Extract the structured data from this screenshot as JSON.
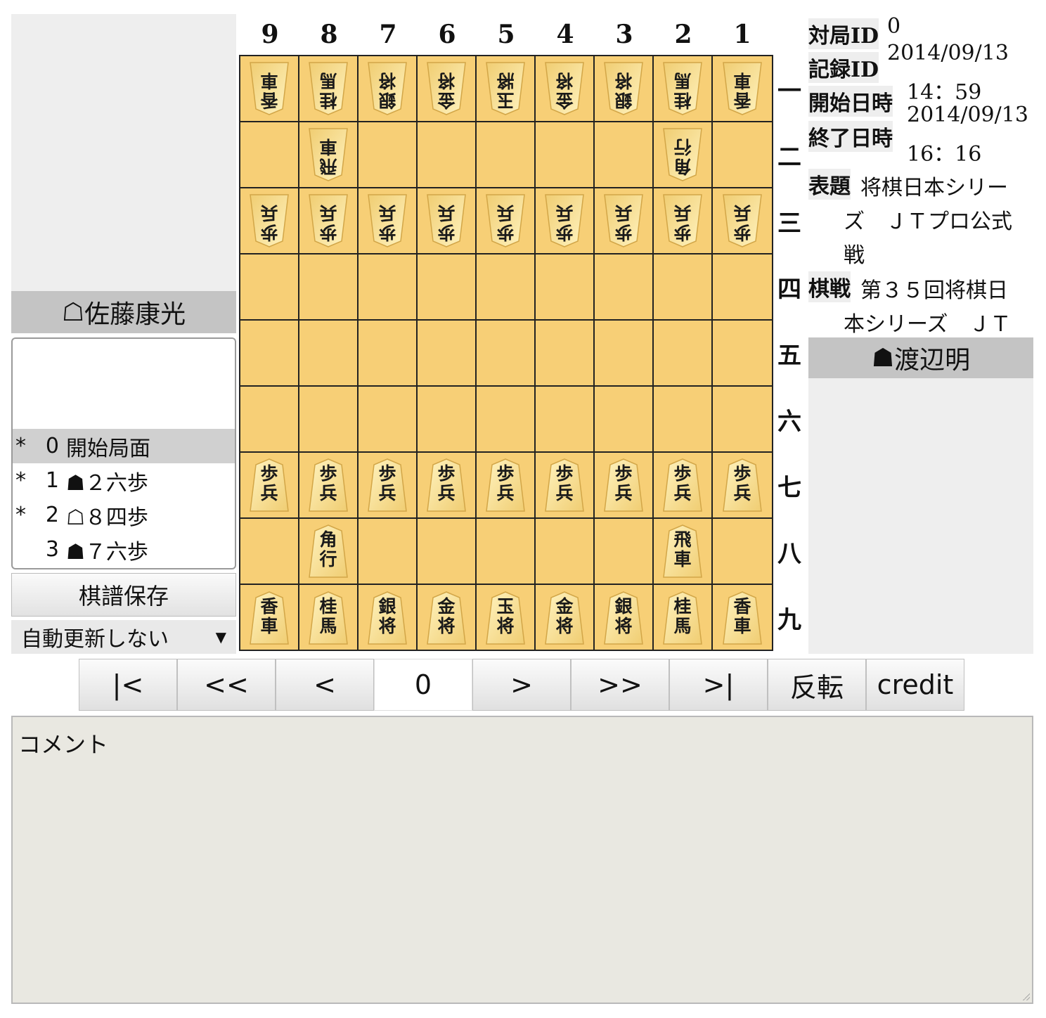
{
  "gote": {
    "mark": "☖",
    "name": "佐藤康光"
  },
  "sente": {
    "mark": "☗",
    "name": "渡辺明"
  },
  "kifu": [
    {
      "star": "*",
      "num": "0",
      "move": "開始局面",
      "selected": true
    },
    {
      "star": "*",
      "num": "1",
      "move": "☗２六歩",
      "selected": false
    },
    {
      "star": "*",
      "num": "2",
      "move": "☖８四歩",
      "selected": false
    },
    {
      "star": "",
      "num": "3",
      "move": "☗７六歩",
      "selected": false
    }
  ],
  "save_button_label": "棋譜保存",
  "auto_update": {
    "selected": "自動更新しない",
    "arrow": "▼"
  },
  "board": {
    "col_labels": [
      "9",
      "8",
      "7",
      "6",
      "5",
      "4",
      "3",
      "2",
      "1"
    ],
    "row_labels": [
      "一",
      "二",
      "三",
      "四",
      "五",
      "六",
      "七",
      "八",
      "九"
    ],
    "rows": [
      [
        [
          "香車",
          "gote"
        ],
        [
          "桂馬",
          "gote"
        ],
        [
          "銀将",
          "gote"
        ],
        [
          "金将",
          "gote"
        ],
        [
          "玉將",
          "gote"
        ],
        [
          "金将",
          "gote"
        ],
        [
          "銀将",
          "gote"
        ],
        [
          "桂馬",
          "gote"
        ],
        [
          "香車",
          "gote"
        ]
      ],
      [
        null,
        [
          "飛車",
          "gote"
        ],
        null,
        null,
        null,
        null,
        null,
        [
          "角行",
          "gote"
        ],
        null
      ],
      [
        [
          "歩兵",
          "gote"
        ],
        [
          "歩兵",
          "gote"
        ],
        [
          "歩兵",
          "gote"
        ],
        [
          "歩兵",
          "gote"
        ],
        [
          "歩兵",
          "gote"
        ],
        [
          "歩兵",
          "gote"
        ],
        [
          "歩兵",
          "gote"
        ],
        [
          "歩兵",
          "gote"
        ],
        [
          "歩兵",
          "gote"
        ]
      ],
      [
        null,
        null,
        null,
        null,
        null,
        null,
        null,
        null,
        null
      ],
      [
        null,
        null,
        null,
        null,
        null,
        null,
        null,
        null,
        null
      ],
      [
        null,
        null,
        null,
        null,
        null,
        null,
        null,
        null,
        null
      ],
      [
        [
          "歩兵",
          "sente"
        ],
        [
          "歩兵",
          "sente"
        ],
        [
          "歩兵",
          "sente"
        ],
        [
          "歩兵",
          "sente"
        ],
        [
          "歩兵",
          "sente"
        ],
        [
          "歩兵",
          "sente"
        ],
        [
          "歩兵",
          "sente"
        ],
        [
          "歩兵",
          "sente"
        ],
        [
          "歩兵",
          "sente"
        ]
      ],
      [
        null,
        [
          "角行",
          "sente"
        ],
        null,
        null,
        null,
        null,
        null,
        [
          "飛車",
          "sente"
        ],
        null
      ],
      [
        [
          "香車",
          "sente"
        ],
        [
          "桂馬",
          "sente"
        ],
        [
          "銀将",
          "sente"
        ],
        [
          "金将",
          "sente"
        ],
        [
          "玉将",
          "sente"
        ],
        [
          "金将",
          "sente"
        ],
        [
          "銀将",
          "sente"
        ],
        [
          "桂馬",
          "sente"
        ],
        [
          "香車",
          "sente"
        ]
      ]
    ]
  },
  "info": {
    "game_id_label": "対局ID",
    "game_id": "0",
    "record_id_label": "記録ID",
    "record_id": "2014/09/13",
    "start_label": "開始日時",
    "start_time": "14：59",
    "start_date2": "2014/09/13",
    "end_label": "終了日時",
    "end_time": "16：16",
    "title_label": "表題",
    "title_line1": "将棋日本シリー",
    "title_line2": "ズ　ＪＴプロ公式",
    "title_line3": "戦",
    "event_label": "棋戦",
    "event_line1": "第３５回将棋日",
    "event_line2": "本シリーズ　ＪＴ"
  },
  "nav": {
    "first": "|<",
    "back10": "<<",
    "back": "<",
    "move_number": "0",
    "forward": ">",
    "forward10": ">>",
    "last": ">|",
    "flip": "反転",
    "credit": "credit"
  },
  "comment": {
    "placeholder": "コメント"
  }
}
